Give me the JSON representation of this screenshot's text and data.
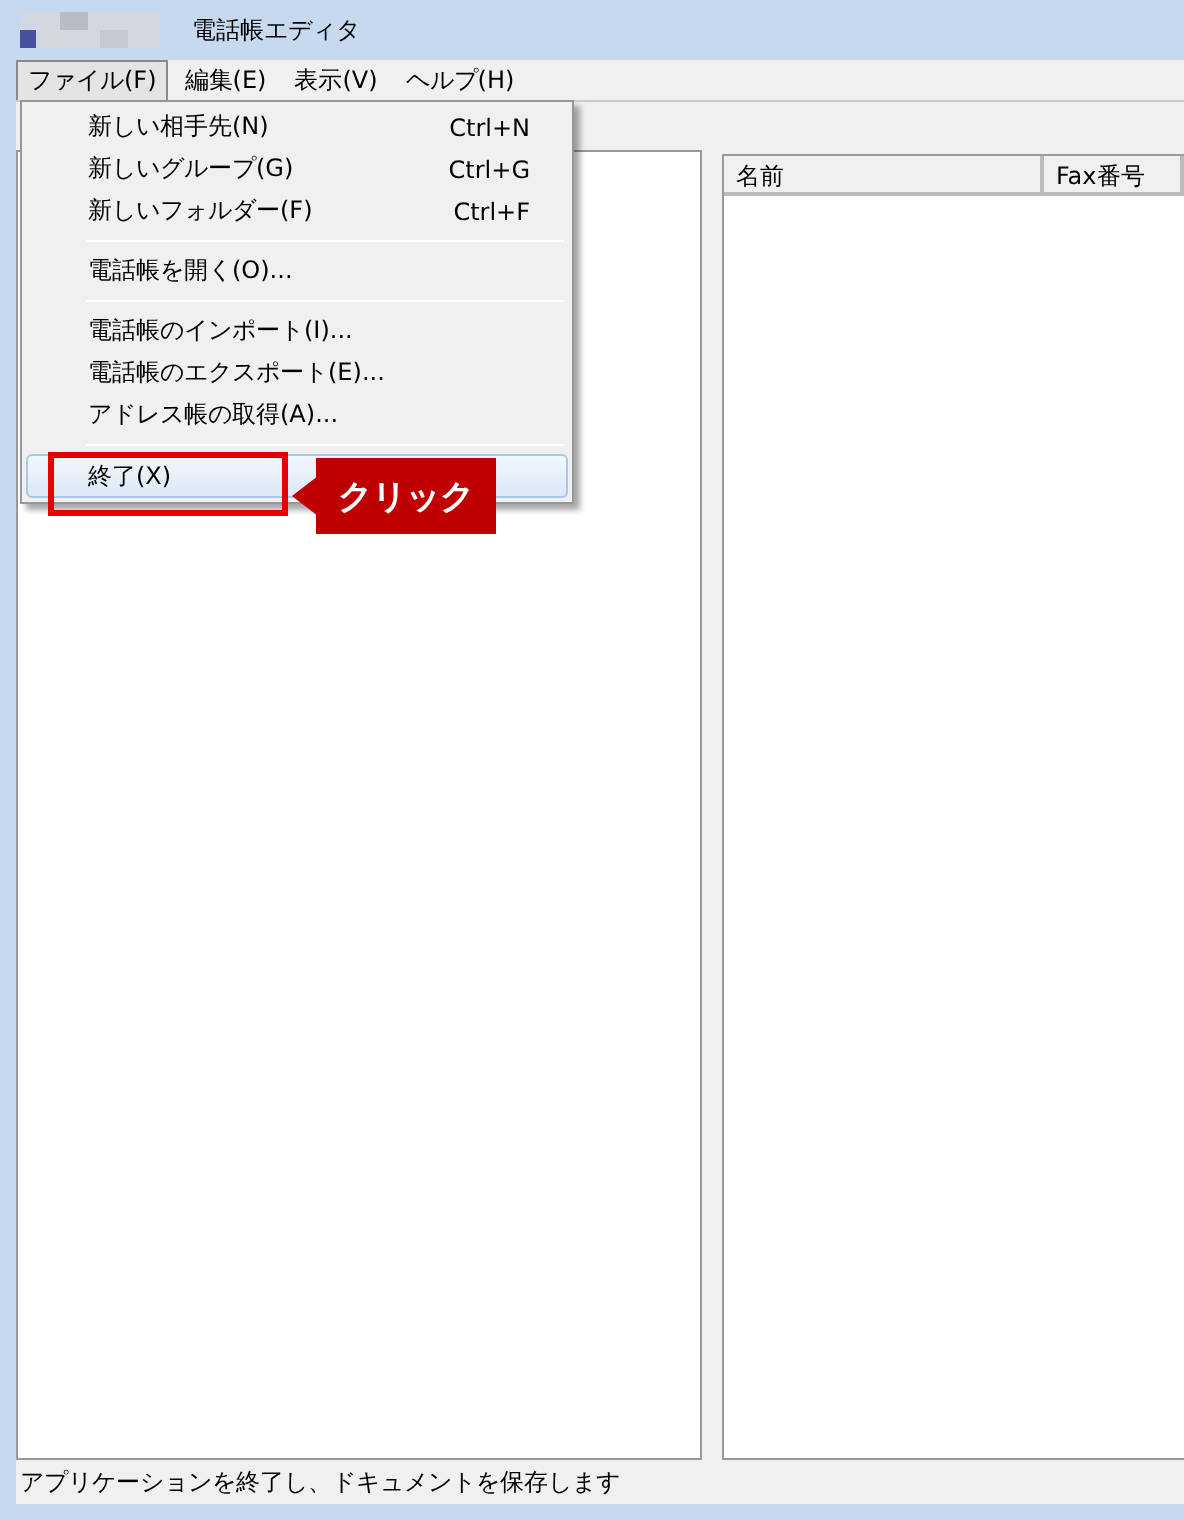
{
  "window": {
    "title": "電話帳エディタ"
  },
  "menu_bar": [
    {
      "label": "ファイル(F)",
      "selected": true
    },
    {
      "label": "編集(E)",
      "selected": false
    },
    {
      "label": "表示(V)",
      "selected": false
    },
    {
      "label": "ヘルプ(H)",
      "selected": false
    }
  ],
  "file_menu": {
    "groups": [
      [
        {
          "label": "新しい相手先(N)",
          "shortcut": "Ctrl+N",
          "highlighted": false
        },
        {
          "label": "新しいグループ(G)",
          "shortcut": "Ctrl+G",
          "highlighted": false
        },
        {
          "label": "新しいフォルダー(F)",
          "shortcut": "Ctrl+F",
          "highlighted": false
        }
      ],
      [
        {
          "label": "電話帳を開く(O)...",
          "highlighted": false
        }
      ],
      [
        {
          "label": "電話帳のインポート(I)...",
          "highlighted": false
        },
        {
          "label": "電話帳のエクスポート(E)...",
          "highlighted": false
        },
        {
          "label": "アドレス帳の取得(A)...",
          "highlighted": false
        }
      ],
      [
        {
          "label": "終了(X)",
          "highlighted": true
        }
      ]
    ]
  },
  "annotation": {
    "callout": "クリック"
  },
  "list": {
    "columns": [
      "名前",
      "Fax番号"
    ]
  },
  "status_bar": "アプリケーションを終了し、ドキュメントを保存します"
}
